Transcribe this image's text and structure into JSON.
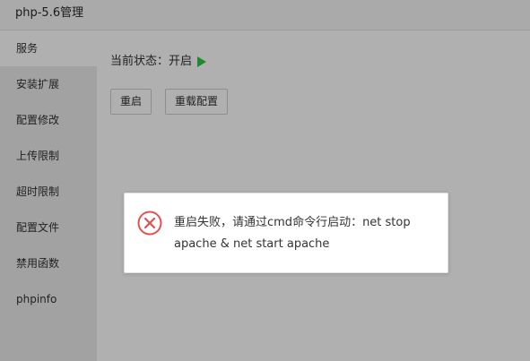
{
  "window": {
    "title": "php-5.6管理"
  },
  "sidebar": {
    "items": [
      {
        "label": "服务",
        "active": true
      },
      {
        "label": "安装扩展",
        "active": false
      },
      {
        "label": "配置修改",
        "active": false
      },
      {
        "label": "上传限制",
        "active": false
      },
      {
        "label": "超时限制",
        "active": false
      },
      {
        "label": "配置文件",
        "active": false
      },
      {
        "label": "禁用函数",
        "active": false
      },
      {
        "label": "phpinfo",
        "active": false
      }
    ]
  },
  "service": {
    "status_label": "当前状态：开启",
    "status_icon": "play-icon",
    "status_color": "#1f8a2c",
    "restart_label": "重启",
    "reload_label": "重载配置"
  },
  "dialog": {
    "icon": "error-circle-icon",
    "icon_color": "#e05151",
    "message": "重启失败，请通过cmd命令行启动：net stop apache & net start apache"
  }
}
